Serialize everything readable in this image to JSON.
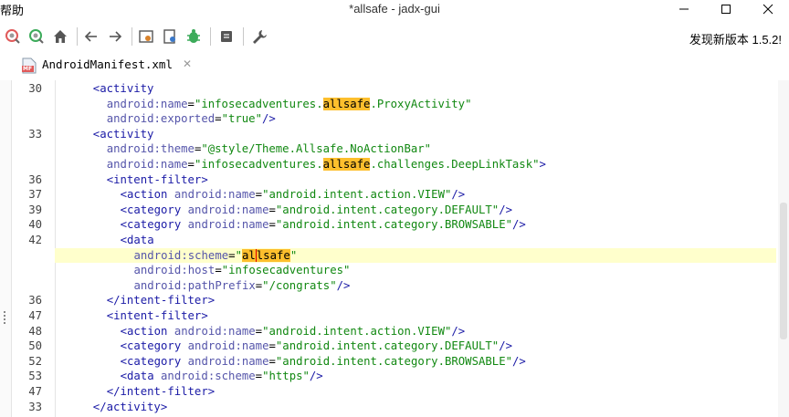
{
  "menu": {
    "help": "帮助"
  },
  "window": {
    "title": "*allsafe - jadx-gui"
  },
  "toolbar": {
    "update_notice": "发现新版本 1.5.2!"
  },
  "tab": {
    "label": "AndroidManifest.xml",
    "badge": "MF"
  },
  "colors": {
    "highlight": "#fdbf2d",
    "current_line": "#ffffcc"
  },
  "lines": [
    {
      "no": "30",
      "indent": 4,
      "parts": [
        [
          "tag",
          "<activity"
        ]
      ]
    },
    {
      "no": "",
      "indent": 6,
      "parts": [
        [
          "attr",
          "android:name"
        ],
        [
          "punct",
          "="
        ],
        [
          "str",
          "\"infosecadventures."
        ],
        [
          "hl",
          "allsafe"
        ],
        [
          "str",
          ".ProxyActivity\""
        ]
      ]
    },
    {
      "no": "",
      "indent": 6,
      "parts": [
        [
          "attr",
          "android:exported"
        ],
        [
          "punct",
          "="
        ],
        [
          "str",
          "\"true\""
        ],
        [
          "tag",
          "/>"
        ]
      ]
    },
    {
      "no": "33",
      "indent": 4,
      "parts": [
        [
          "tag",
          "<activity"
        ]
      ]
    },
    {
      "no": "",
      "indent": 6,
      "parts": [
        [
          "attr",
          "android:theme"
        ],
        [
          "punct",
          "="
        ],
        [
          "str",
          "\"@style/Theme.Allsafe.NoActionBar\""
        ]
      ]
    },
    {
      "no": "",
      "indent": 6,
      "parts": [
        [
          "attr",
          "android:name"
        ],
        [
          "punct",
          "="
        ],
        [
          "str",
          "\"infosecadventures."
        ],
        [
          "hl",
          "allsafe"
        ],
        [
          "str",
          ".challenges.DeepLinkTask\""
        ],
        [
          "tag",
          ">"
        ]
      ]
    },
    {
      "no": "36",
      "indent": 6,
      "parts": [
        [
          "tag",
          "<intent-filter>"
        ]
      ]
    },
    {
      "no": "37",
      "indent": 8,
      "parts": [
        [
          "tag",
          "<action "
        ],
        [
          "attr",
          "android:name"
        ],
        [
          "punct",
          "="
        ],
        [
          "str",
          "\"android.intent.action.VIEW\""
        ],
        [
          "tag",
          "/>"
        ]
      ]
    },
    {
      "no": "39",
      "indent": 8,
      "parts": [
        [
          "tag",
          "<category "
        ],
        [
          "attr",
          "android:name"
        ],
        [
          "punct",
          "="
        ],
        [
          "str",
          "\"android.intent.category.DEFAULT\""
        ],
        [
          "tag",
          "/>"
        ]
      ]
    },
    {
      "no": "40",
      "indent": 8,
      "parts": [
        [
          "tag",
          "<category "
        ],
        [
          "attr",
          "android:name"
        ],
        [
          "punct",
          "="
        ],
        [
          "str",
          "\"android.intent.category.BROWSABLE\""
        ],
        [
          "tag",
          "/>"
        ]
      ]
    },
    {
      "no": "42",
      "indent": 8,
      "parts": [
        [
          "tag",
          "<data"
        ]
      ]
    },
    {
      "no": "",
      "indent": 10,
      "current": true,
      "parts": [
        [
          "attr",
          "android:scheme"
        ],
        [
          "punct",
          "="
        ],
        [
          "str",
          "\""
        ],
        [
          "hl",
          "al"
        ],
        [
          "caret",
          ""
        ],
        [
          "hl",
          "lsafe"
        ],
        [
          "str",
          "\""
        ]
      ]
    },
    {
      "no": "",
      "indent": 10,
      "parts": [
        [
          "attr",
          "android:host"
        ],
        [
          "punct",
          "="
        ],
        [
          "str",
          "\"infosecadventures\""
        ]
      ]
    },
    {
      "no": "",
      "indent": 10,
      "parts": [
        [
          "attr",
          "android:pathPrefix"
        ],
        [
          "punct",
          "="
        ],
        [
          "str",
          "\"/congrats\""
        ],
        [
          "tag",
          "/>"
        ]
      ]
    },
    {
      "no": "36",
      "indent": 6,
      "parts": [
        [
          "tag",
          "</intent-filter>"
        ]
      ]
    },
    {
      "no": "47",
      "indent": 6,
      "parts": [
        [
          "tag",
          "<intent-filter>"
        ]
      ]
    },
    {
      "no": "48",
      "indent": 8,
      "parts": [
        [
          "tag",
          "<action "
        ],
        [
          "attr",
          "android:name"
        ],
        [
          "punct",
          "="
        ],
        [
          "str",
          "\"android.intent.action.VIEW\""
        ],
        [
          "tag",
          "/>"
        ]
      ]
    },
    {
      "no": "50",
      "indent": 8,
      "parts": [
        [
          "tag",
          "<category "
        ],
        [
          "attr",
          "android:name"
        ],
        [
          "punct",
          "="
        ],
        [
          "str",
          "\"android.intent.category.DEFAULT\""
        ],
        [
          "tag",
          "/>"
        ]
      ]
    },
    {
      "no": "52",
      "indent": 8,
      "parts": [
        [
          "tag",
          "<category "
        ],
        [
          "attr",
          "android:name"
        ],
        [
          "punct",
          "="
        ],
        [
          "str",
          "\"android.intent.category.BROWSABLE\""
        ],
        [
          "tag",
          "/>"
        ]
      ]
    },
    {
      "no": "53",
      "indent": 8,
      "parts": [
        [
          "tag",
          "<data "
        ],
        [
          "attr",
          "android:scheme"
        ],
        [
          "punct",
          "="
        ],
        [
          "str",
          "\"https\""
        ],
        [
          "tag",
          "/>"
        ]
      ]
    },
    {
      "no": "47",
      "indent": 6,
      "parts": [
        [
          "tag",
          "</intent-filter>"
        ]
      ]
    },
    {
      "no": "33",
      "indent": 4,
      "parts": [
        [
          "tag",
          "</activity>"
        ]
      ]
    }
  ]
}
